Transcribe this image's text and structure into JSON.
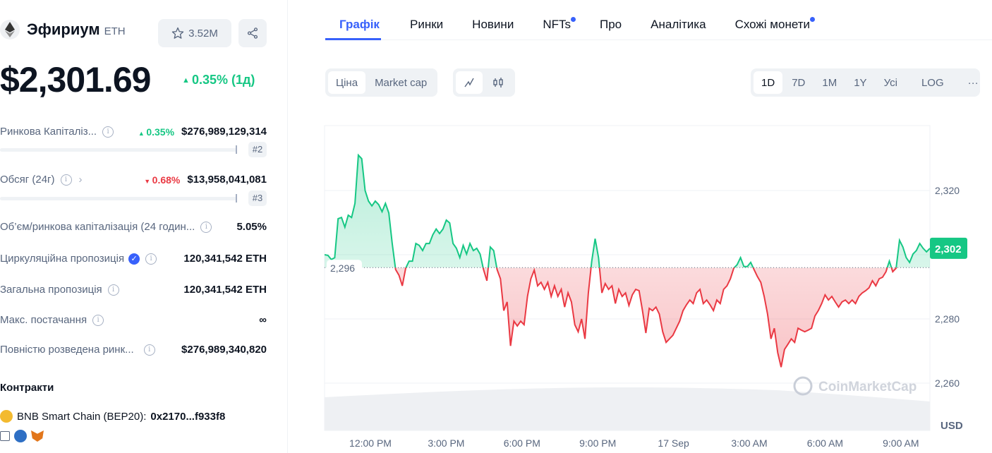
{
  "coin": {
    "name": "Эфириум",
    "symbol": "ETH",
    "watchlist_count": "3.52M",
    "price": "$2,301.69",
    "change": "0.35% (1д)"
  },
  "stats": [
    {
      "label": "Ринкова Капіталіз...",
      "change": "0.35%",
      "direction": "up",
      "value": "$276,989,129,314",
      "rank": "#2"
    },
    {
      "label": "Обсяг (24г)",
      "change": "0.68%",
      "direction": "down",
      "value": "$13,958,041,081",
      "rank": "#3"
    },
    {
      "label": "Об’єм/ринкова капіталізація (24 годин...",
      "value": "5.05%"
    },
    {
      "label": "Циркуляційна пропозиція",
      "value": "120,341,542 ETH"
    },
    {
      "label": "Загальна пропозиція",
      "value": "120,341,542 ETH"
    },
    {
      "label": "Макс. постачання",
      "value": "∞"
    },
    {
      "label": "Повністю розведена ринк...",
      "value": "$276,989,340,820"
    }
  ],
  "contracts": {
    "title": "Контракти",
    "chain": "BNB Smart Chain (BEP20):",
    "address": "0x2170...f933f8"
  },
  "tabs": [
    {
      "label": "Графік",
      "active": true
    },
    {
      "label": "Ринки"
    },
    {
      "label": "Новини"
    },
    {
      "label": "NFTs",
      "dot": true
    },
    {
      "label": "Про"
    },
    {
      "label": "Аналітика"
    },
    {
      "label": "Схожі монети",
      "dot": true
    }
  ],
  "chart_controls": {
    "type_options": [
      "Ціна",
      "Market cap"
    ],
    "selected_type": "Ціна",
    "ranges": [
      "1D",
      "7D",
      "1M",
      "1Y",
      "Усі"
    ],
    "selected_range": "1D",
    "log": "LOG",
    "more": "···"
  },
  "colors": {
    "up": "#16c784",
    "down": "#ea3943",
    "accent": "#3861fb"
  },
  "chart_data": {
    "type": "area",
    "y_ticks": [
      "2,320",
      "2,280",
      "2,260"
    ],
    "y_tick_values": [
      2320,
      2280,
      2260
    ],
    "ylim": [
      2251,
      2342
    ],
    "x_ticks": [
      "12:00 PM",
      "3:00 PM",
      "6:00 PM",
      "9:00 PM",
      "17 Sep",
      "3:00 AM",
      "6:00 AM",
      "9:00 AM"
    ],
    "baseline": 2296,
    "baseline_label": "2,296",
    "current": 2302,
    "current_label": "2,302",
    "unit": "USD",
    "watermark": "CoinMarketCap",
    "prices": [
      2300,
      2299.8,
      2298.5,
      2299.1,
      2311.2,
      2311.6,
      2308.6,
      2312.3,
      2311.6,
      2316,
      2331,
      2329.9,
      2320,
      2316.7,
      2315.2,
      2316.7,
      2315.6,
      2313.4,
      2316,
      2313,
      2303.5,
      2295.4,
      2293.6,
      2290.3,
      2295.8,
      2298,
      2298,
      2303.5,
      2302.9,
      2301.3,
      2303.5,
      2303.5,
      2306.2,
      2308,
      2306.6,
      2308,
      2310.8,
      2309.9,
      2303.5,
      2302,
      2299.1,
      2302.9,
      2300.2,
      2303.5,
      2301.3,
      2302,
      2300.2,
      2295.4,
      2291.9,
      2302.4,
      2301.3,
      2295.4,
      2292.5,
      2282.6,
      2285.3,
      2271.6,
      2279.3,
      2277.8,
      2279.3,
      2278.2,
      2287,
      2292.5,
      2295.2,
      2290.3,
      2291.4,
      2289.2,
      2291.4,
      2287,
      2290.3,
      2287,
      2289.2,
      2283.7,
      2288.1,
      2285.3,
      2278.2,
      2276,
      2280,
      2273.8,
      2288.1,
      2298,
      2305,
      2299.1,
      2288.1,
      2291,
      2289.2,
      2290.3,
      2284.8,
      2289.2,
      2287,
      2288.1,
      2284.2,
      2287.5,
      2289.2,
      2288.8,
      2282.6,
      2275.6,
      2283.3,
      2282.6,
      2283.7,
      2281.5,
      2276,
      2272.7,
      2273.8,
      2274.9,
      2277.1,
      2279.3,
      2282.6,
      2284.4,
      2285.9,
      2284.8,
      2288.1,
      2289.2,
      2284.8,
      2285.9,
      2284.4,
      2282.6,
      2285.9,
      2284.8,
      2289.2,
      2290.3,
      2292.5,
      2295.8,
      2296.9,
      2299.1,
      2296.3,
      2296.3,
      2297.6,
      2295.4,
      2293.2,
      2291.4,
      2287,
      2281.5,
      2273.8,
      2277.1,
      2269.5,
      2265,
      2270.5,
      2272.1,
      2273.8,
      2272.7,
      2277.1,
      2276.5,
      2276,
      2276.5,
      2277.1,
      2280.9,
      2282.6,
      2284.8,
      2287.5,
      2285.9,
      2287,
      2285.3,
      2283.7,
      2285.3,
      2285.9,
      2284.8,
      2285.9,
      2284.8,
      2287,
      2288.1,
      2288.8,
      2289.7,
      2291.9,
      2290.3,
      2292.5,
      2293,
      2294.7,
      2298,
      2294.7,
      2295.8,
      2304.5,
      2302.4,
      2299.1,
      2297.6,
      2300.2,
      2301.3,
      2303.5,
      2302,
      2300.9,
      2302
    ]
  }
}
